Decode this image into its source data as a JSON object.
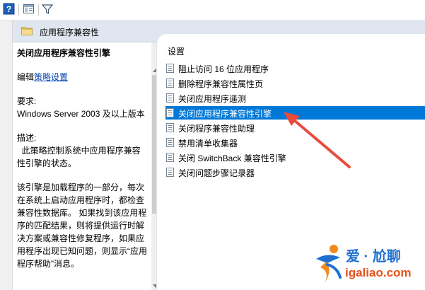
{
  "toolbar": {
    "icons": [
      "help-icon",
      "show-hide-pane-icon",
      "filter-icon"
    ]
  },
  "header": {
    "folder_icon": "folder-icon",
    "title": "应用程序兼容性"
  },
  "description": {
    "title": "关闭应用程序兼容性引擎",
    "edit_prefix": "编辑",
    "edit_link": "策略设置",
    "requirements_label": "要求:",
    "requirements_value": "Windows Server 2003 及以上版本",
    "description_label": "描述:",
    "description_text": "  此策略控制系统中应用程序兼容性引擎的状态。",
    "more_text": "该引擎是加载程序的一部分，每次在系统上启动应用程序时，都检查兼容性数据库。 如果找到该应用程序的匹配结果，则将提供运行时解决方案或兼容性修复程序，如果应用程序出现已知问题，则显示“应用程序帮助”消息。"
  },
  "settings_list": {
    "header": "设置",
    "selected_index": 3,
    "items": [
      {
        "label": "阻止访问 16 位应用程序"
      },
      {
        "label": "删除程序兼容性属性页"
      },
      {
        "label": "关闭应用程序遥测"
      },
      {
        "label": "关闭应用程序兼容性引擎"
      },
      {
        "label": "关闭程序兼容性助理"
      },
      {
        "label": "禁用清单收集器"
      },
      {
        "label": "关闭 SwitchBack 兼容性引擎"
      },
      {
        "label": "关闭问题步骤记录器"
      }
    ]
  },
  "colors": {
    "selection": "#0078d7",
    "header_band": "#dfe6ef",
    "arrow": "#e84b3c",
    "link": "#0645ad"
  },
  "watermark": {
    "text_cn": "爱 · 尬聊",
    "url": "igaliao.com"
  }
}
